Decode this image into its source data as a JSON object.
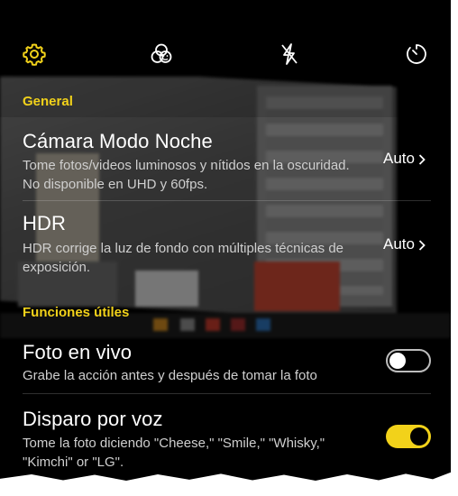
{
  "toolbar": {
    "settings_icon": "gear-icon",
    "filter_icon": "filters-icon",
    "flash_icon": "flash-off-icon",
    "timer_icon": "timer-icon"
  },
  "sections": {
    "general": "General",
    "useful": "Funciones útiles"
  },
  "settings": {
    "night_mode": {
      "title": "Cámara Modo Noche",
      "desc": "Tome fotos/videos luminosos y nítidos en la oscuridad. No disponible en UHD y 60fps.",
      "value": "Auto"
    },
    "hdr": {
      "title": "HDR",
      "desc": "HDR corrige la luz de fondo con múltiples técnicas de exposición.",
      "value": "Auto"
    },
    "live_photo": {
      "title": "Foto en vivo",
      "desc": "Grabe la acción antes y después de tomar la foto",
      "enabled": false
    },
    "voice_shot": {
      "title": "Disparo por voz",
      "desc": "Tome la foto diciendo \"Cheese,\" \"Smile,\" \"Whisky,\" \"Kimchi\" or \"LG\".",
      "enabled": true
    }
  },
  "colors": {
    "accent": "#f2d21a",
    "background": "#000000",
    "text": "#ffffff",
    "subtext": "#cfcfcf"
  }
}
